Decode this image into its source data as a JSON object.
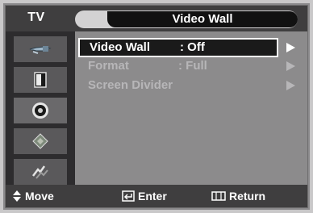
{
  "header": {
    "source_label": "TV",
    "title": "Video Wall"
  },
  "sidebar": {
    "items": [
      {
        "icon": "input-plug-icon"
      },
      {
        "icon": "picture-icon"
      },
      {
        "icon": "speaker-icon"
      },
      {
        "icon": "channel-icon"
      },
      {
        "icon": "setup-icon"
      }
    ]
  },
  "menu": {
    "items": [
      {
        "label": "Video Wall",
        "value": ": Off",
        "selected": true
      },
      {
        "label": "Format",
        "value": ": Full",
        "selected": false
      },
      {
        "label": "Screen Divider",
        "value": "",
        "selected": false
      }
    ]
  },
  "footer": {
    "move_label": "Move",
    "enter_label": "Enter",
    "return_label": "Return"
  },
  "colors": {
    "osd_background": "#8c8b8c",
    "bar_dark": "#3f3e3f",
    "selected_text": "#ffffff",
    "dim_text": "#b7b6b8"
  }
}
